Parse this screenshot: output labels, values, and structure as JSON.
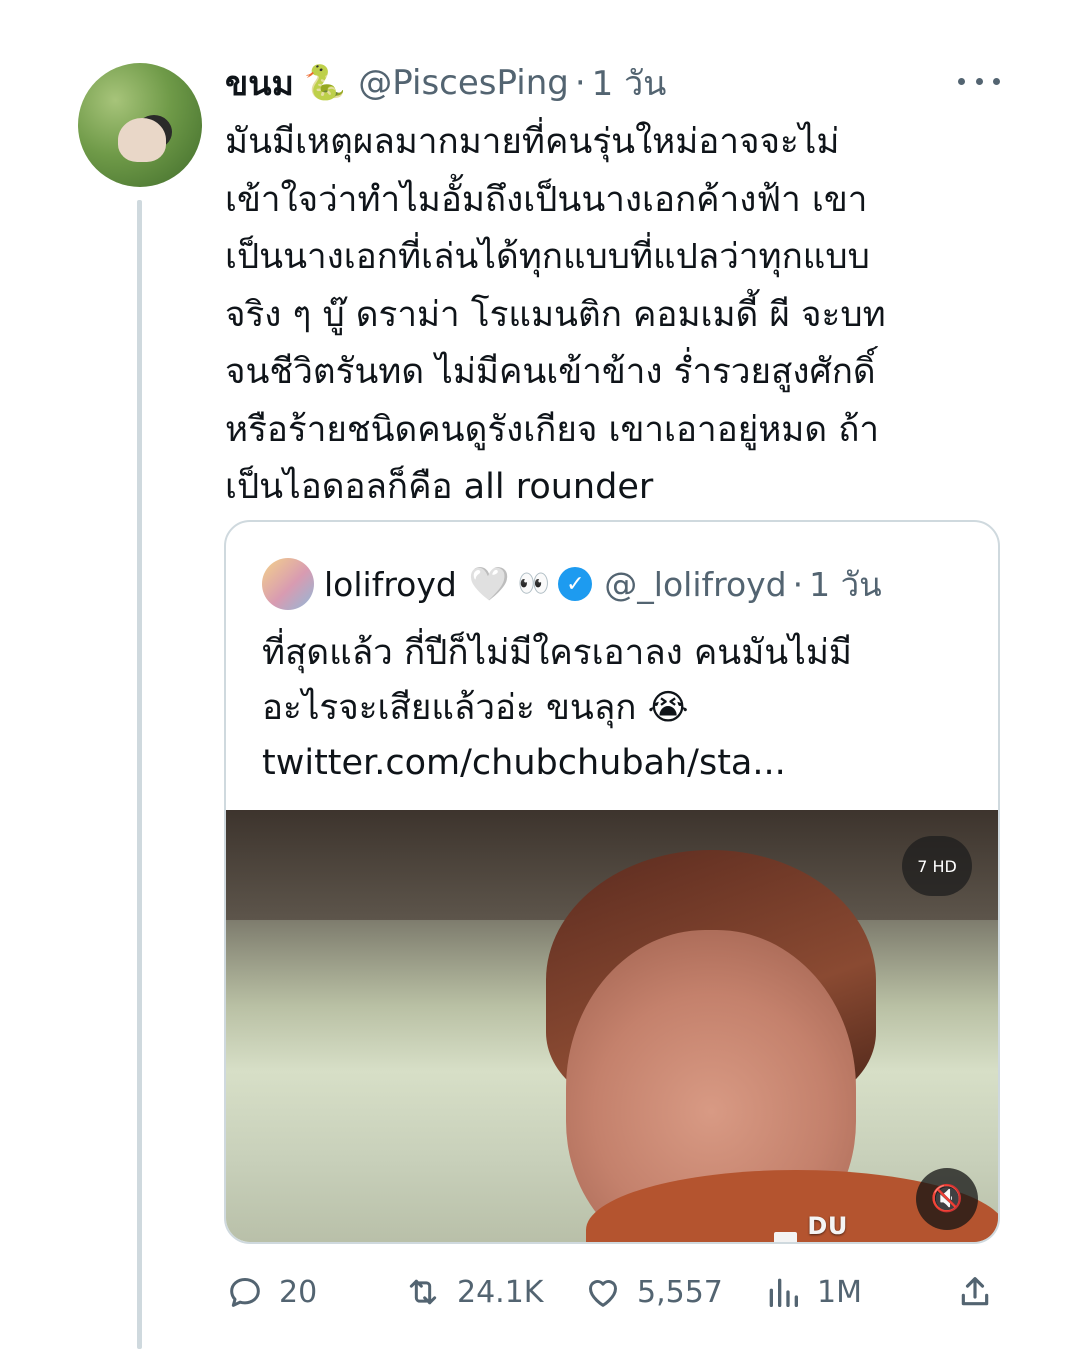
{
  "tweet": {
    "author_name": "ขนม",
    "author_emoji": "🐍",
    "handle": "@PiscesPing",
    "separator": "·",
    "time": "1 วัน",
    "text": "มันมีเหตุผลมากมายที่คนรุ่นใหม่อาจจะไม่\nเข้าใจว่าทำไมอั้มถึงเป็นนางเอกค้างฟ้า เขา\nเป็นนางเอกที่เล่นได้ทุกแบบที่แปลว่าทุกแบบ\nจริง ๆ บู๊ ดราม่า โรแมนติก คอมเมดี้ ผี จะบท\nจนชีวิตรันทด ไม่มีคนเข้าข้าง ร่ำรวยสูงศักดิ์\nหรือร้ายชนิดคนดูรังเกียจ เขาเอาอยู่หมด ถ้า\nเป็นไอดอลก็คือ all rounder"
  },
  "quote": {
    "author_name": "lolifroyd",
    "heart": "🤍",
    "eyes": "👀",
    "verified": "✓",
    "handle": "@_lolifroyd",
    "separator": "·",
    "time": "1 วัน",
    "text": "ที่สุดแล้ว กี่ปีก็ไม่มีใครเอาลง คนมันไม่มี\nอะไรจะเสียแล้วอ่ะ ขนลุก 😭\ntwitter.com/chubchubah/sta...",
    "media": {
      "channel_badge": "7 HD",
      "mute_icon": "🔇",
      "watermark": "DU RECORDER"
    }
  },
  "actions": {
    "replies": "20",
    "retweets": "24.1K",
    "likes": "5,557",
    "views": "1M"
  },
  "colors": {
    "text": "#0f1419",
    "secondary": "#536471",
    "border": "#cfd9de",
    "verified": "#1d9bf0"
  }
}
